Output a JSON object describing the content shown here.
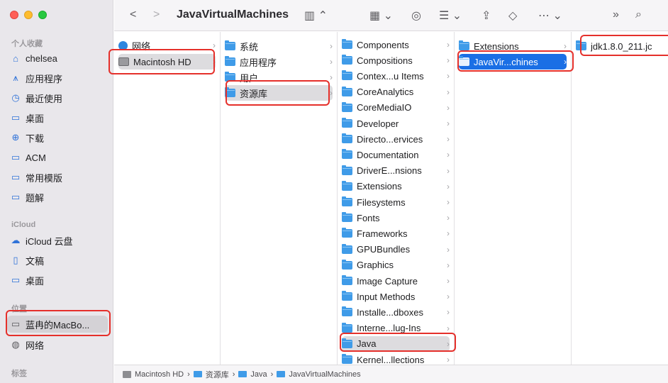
{
  "toolbar": {
    "title": "JavaVirtualMachines"
  },
  "sidebar": {
    "sections": {
      "favorites": "个人收藏",
      "icloud": "iCloud",
      "locations": "位置",
      "tags": "标签"
    },
    "favorites": [
      {
        "label": "chelsea",
        "icon": "home-icon"
      },
      {
        "label": "应用程序",
        "icon": "apps-icon"
      },
      {
        "label": "最近使用",
        "icon": "clock-icon"
      },
      {
        "label": "桌面",
        "icon": "desktop-icon"
      },
      {
        "label": "下载",
        "icon": "download-icon"
      },
      {
        "label": "ACM",
        "icon": "folder-icon"
      },
      {
        "label": "常用模版",
        "icon": "folder-icon"
      },
      {
        "label": "题解",
        "icon": "folder-icon"
      }
    ],
    "icloud": [
      {
        "label": "iCloud 云盘",
        "icon": "cloud-icon"
      },
      {
        "label": "文稿",
        "icon": "document-icon"
      },
      {
        "label": "桌面",
        "icon": "desktop-icon"
      }
    ],
    "locations": [
      {
        "label": "蓝冉的MacBo...",
        "icon": "laptop-icon"
      },
      {
        "label": "网络",
        "icon": "globe-icon"
      }
    ]
  },
  "columns": {
    "col1": [
      {
        "label": "网络",
        "icon": "globe-icon"
      },
      {
        "label": "Macintosh HD",
        "icon": "disk-icon"
      }
    ],
    "col2": [
      {
        "label": "系统"
      },
      {
        "label": "应用程序"
      },
      {
        "label": "用户"
      },
      {
        "label": "资源库"
      }
    ],
    "col3": [
      {
        "label": "Components"
      },
      {
        "label": "Compositions"
      },
      {
        "label": "Contex...u Items"
      },
      {
        "label": "CoreAnalytics"
      },
      {
        "label": "CoreMediaIO"
      },
      {
        "label": "Developer"
      },
      {
        "label": "Directo...ervices"
      },
      {
        "label": "Documentation"
      },
      {
        "label": "DriverE...nsions"
      },
      {
        "label": "Extensions"
      },
      {
        "label": "Filesystems"
      },
      {
        "label": "Fonts"
      },
      {
        "label": "Frameworks"
      },
      {
        "label": "GPUBundles"
      },
      {
        "label": "Graphics"
      },
      {
        "label": "Image Capture"
      },
      {
        "label": "Input Methods"
      },
      {
        "label": "Installe...dboxes"
      },
      {
        "label": "Interne...lug-Ins"
      },
      {
        "label": "Java"
      },
      {
        "label": "Kernel...llections"
      }
    ],
    "col4": [
      {
        "label": "Extensions"
      },
      {
        "label": "JavaVir...chines"
      }
    ],
    "col5": [
      {
        "label": "jdk1.8.0_211.jc"
      }
    ]
  },
  "pathbar": {
    "items": [
      "Macintosh HD",
      "资源库",
      "Java",
      "JavaVirtualMachines"
    ]
  },
  "colors": {
    "accent": "#1a6fe5",
    "annotation": "#e5302b",
    "folder": "#3f9be8"
  }
}
